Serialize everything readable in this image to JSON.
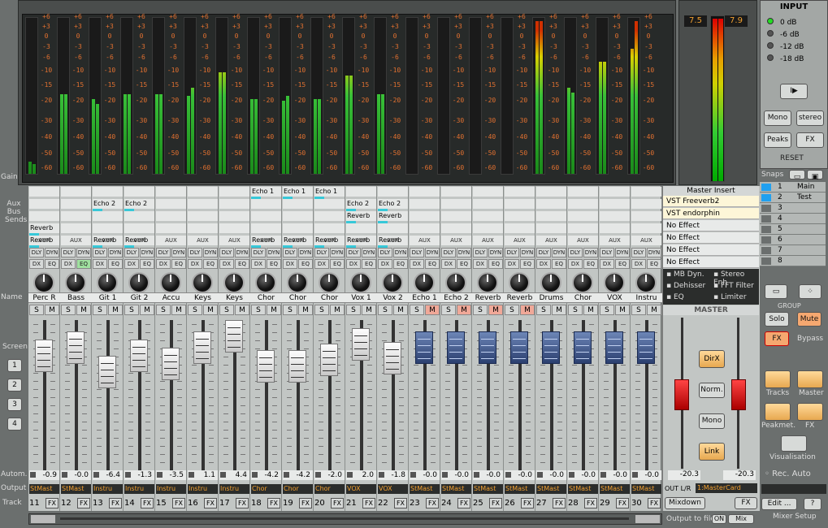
{
  "left_labels": {
    "gain": "Gain",
    "aux_bus_sends": [
      "Aux",
      "Bus",
      "Sends"
    ],
    "name": "Name",
    "screen": "Screen",
    "screen_buttons": [
      "1",
      "2",
      "3",
      "4"
    ],
    "autom": "Autom.",
    "output": "Output",
    "track": "Track"
  },
  "meter_scale": [
    "+6",
    "+3",
    "0",
    "-3",
    "-6",
    "-10",
    "-15",
    "-20",
    "-30",
    "-40",
    "-50",
    "-60"
  ],
  "channels": [
    {
      "name": "Perc R",
      "db": "-0.9",
      "out": "StMast",
      "track": "11",
      "sends": [
        "",
        "",
        "",
        "Reverb",
        "Reverb"
      ],
      "l": 0.08,
      "r": 0.06
    },
    {
      "name": "Bass",
      "db": "-0.0",
      "out": "StMast",
      "track": "12",
      "sends": [
        "",
        "",
        "",
        "",
        ""
      ],
      "l": 0.51,
      "r": 0.51
    },
    {
      "name": "Git 1",
      "db": "-6.4",
      "out": "Instru",
      "track": "13",
      "sends": [
        "",
        "Echo 2",
        "",
        "",
        "Reverb"
      ],
      "l": 0.48,
      "r": 0.45
    },
    {
      "name": "Git 2",
      "db": "-1.3",
      "out": "Instru",
      "track": "14",
      "sends": [
        "",
        "Echo 2",
        "",
        "",
        "Reverb"
      ],
      "l": 0.51,
      "r": 0.51
    },
    {
      "name": "Accu",
      "db": "-3.5",
      "out": "Instru",
      "track": "15",
      "sends": [
        "",
        "",
        "",
        "",
        ""
      ],
      "l": 0.51,
      "r": 0.51
    },
    {
      "name": "Keys",
      "db": "1.1",
      "out": "Instru",
      "track": "16",
      "sends": [
        "",
        "",
        "",
        "",
        ""
      ],
      "l": 0.5,
      "r": 0.55
    },
    {
      "name": "Keys",
      "db": "4.4",
      "out": "Instru",
      "track": "17",
      "sends": [
        "",
        "",
        "",
        "",
        ""
      ],
      "l": 0.65,
      "r": 0.65
    },
    {
      "name": "Chor",
      "db": "-4.2",
      "out": "Chor",
      "track": "18",
      "sends": [
        "Echo 1",
        "",
        "",
        "",
        "Reverb"
      ],
      "l": 0.48,
      "r": 0.48
    },
    {
      "name": "Chor",
      "db": "-4.2",
      "out": "Chor",
      "track": "19",
      "sends": [
        "Echo 1",
        "",
        "",
        "",
        "Reverb"
      ],
      "l": 0.47,
      "r": 0.5
    },
    {
      "name": "Chor",
      "db": "-2.0",
      "out": "Chor",
      "track": "20",
      "sends": [
        "Echo 1",
        "",
        "",
        "",
        "Reverb"
      ],
      "l": 0.48,
      "r": 0.48
    },
    {
      "name": "Vox 1",
      "db": "2.0",
      "out": "VOX",
      "track": "21",
      "sends": [
        "",
        "Echo 2",
        "Reverb",
        "",
        "Reverb"
      ],
      "l": 0.63,
      "r": 0.63
    },
    {
      "name": "Vox 2",
      "db": "-1.8",
      "out": "VOX",
      "track": "22",
      "sends": [
        "",
        "Echo 2",
        "Reverb",
        "",
        "Reverb"
      ],
      "l": 0.51,
      "r": 0.51
    },
    {
      "name": "Echo 1",
      "db": "-0.0",
      "out": "StMast",
      "track": "23",
      "sends": [
        "",
        "",
        "",
        "",
        ""
      ],
      "l": 0.0,
      "r": 0.0
    },
    {
      "name": "Echo 2",
      "db": "-0.0",
      "out": "StMast",
      "track": "24",
      "sends": [
        "",
        "",
        "",
        "",
        ""
      ],
      "l": 0.0,
      "r": 0.0
    },
    {
      "name": "Reverb",
      "db": "-0.0",
      "out": "StMast",
      "track": "25",
      "sends": [
        "",
        "",
        "",
        "",
        ""
      ],
      "l": 0.0,
      "r": 0.0
    },
    {
      "name": "Reverb",
      "db": "-0.0",
      "out": "StMast",
      "track": "26",
      "sends": [
        "",
        "",
        "",
        "",
        ""
      ],
      "l": 0.0,
      "r": 0.0
    },
    {
      "name": "Drums",
      "db": "-0.0",
      "out": "StMast",
      "track": "27",
      "sends": [
        "",
        "",
        "",
        "",
        ""
      ],
      "l": 0.98,
      "r": 0.98
    },
    {
      "name": "Chor",
      "db": "-0.0",
      "out": "StMast",
      "track": "28",
      "sends": [
        "",
        "",
        "",
        "",
        ""
      ],
      "l": 0.55,
      "r": 0.52
    },
    {
      "name": "VOX",
      "db": "-0.0",
      "out": "StMast",
      "track": "29",
      "sends": [
        "",
        "",
        "",
        "",
        ""
      ],
      "l": 0.72,
      "r": 0.72
    },
    {
      "name": "Instru",
      "db": "-0.0",
      "out": "StMast",
      "track": "30",
      "sends": [
        "",
        "",
        "",
        "",
        ""
      ],
      "l": 0.8,
      "r": 0.98
    }
  ],
  "strip_buttons": {
    "aux": "AUX",
    "dly": "DLY",
    "dyn": "DYN",
    "dx": "DX",
    "eq": "EQ",
    "s": "S",
    "m": "M",
    "fx": "FX"
  },
  "master": {
    "insert_title": "Master Insert",
    "inserts": [
      "VST Freeverb2",
      "VST endorphin",
      "No Effect",
      "No Effect",
      "No Effect",
      "No Effect"
    ],
    "options": [
      "MB Dyn.",
      "Stereo Enh",
      "Dehisser",
      "FFT Filter",
      "EQ",
      "Limiter"
    ],
    "title": "MASTER",
    "buttons": [
      "DirX",
      "Norm.",
      "Mono",
      "Link"
    ],
    "left_db": "-20.3",
    "right_db": "-20.3",
    "peak_left": "7.5",
    "peak_right": "7.9",
    "out_label": "OUT L/R",
    "out_value": "1:MasterCard",
    "mixdown": "Mixdown",
    "fx": "FX",
    "scale": [
      "5",
      "0",
      "5",
      "10",
      "20",
      "30",
      "40",
      "50",
      "∞"
    ]
  },
  "input": {
    "title": "INPUT",
    "levels": [
      "0 dB",
      "-6 dB",
      "-12 dB",
      "-18 dB"
    ]
  },
  "right_panel": {
    "play": "I▶",
    "mono": "Mono",
    "stereo": "stereo",
    "peaks": "Peaks",
    "fx": "FX",
    "reset": "RESET",
    "snaps_label": "Snaps",
    "snaps": [
      {
        "n": "1",
        "name": "Main"
      },
      {
        "n": "2",
        "name": "Test"
      },
      {
        "n": "3",
        "name": ""
      },
      {
        "n": "4",
        "name": ""
      },
      {
        "n": "5",
        "name": ""
      },
      {
        "n": "6",
        "name": ""
      },
      {
        "n": "7",
        "name": ""
      },
      {
        "n": "8",
        "name": ""
      }
    ],
    "group": "GROUP",
    "solo": "Solo",
    "mute": "Mute",
    "fx_btn": "FX",
    "bypass": "Bypass",
    "tracks": "Tracks",
    "master": "Master",
    "peakmet": "Peakmet.",
    "fx2": "FX",
    "visualisation": "Visualisation",
    "rec_auto": "Rec. Auto",
    "edit": "Edit ...",
    "help": "?",
    "mixer_setup": "Mixer Setup"
  },
  "bottom": {
    "output_to_file": "Output to file",
    "on": "ON",
    "mix": "Mix"
  }
}
